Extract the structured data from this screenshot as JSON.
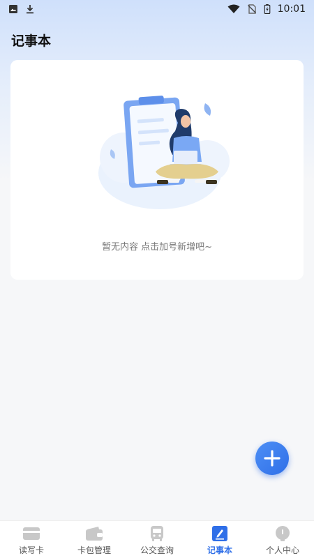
{
  "status_bar": {
    "time": "10:01",
    "icons": [
      "image-icon",
      "download-icon",
      "wifi-icon",
      "no-sim-icon",
      "battery-icon"
    ]
  },
  "page": {
    "title": "记事本"
  },
  "empty_state": {
    "message": "暂无内容 点击加号新增吧~",
    "illustration": "woman-with-laptop-clipboard-illustration"
  },
  "fab": {
    "icon": "plus-icon"
  },
  "tab_bar": {
    "active_index": 3,
    "tabs": [
      {
        "label": "读写卡",
        "icon": "card-icon"
      },
      {
        "label": "卡包管理",
        "icon": "wallet-icon"
      },
      {
        "label": "公交查询",
        "icon": "bus-icon"
      },
      {
        "label": "记事本",
        "icon": "notepad-icon"
      },
      {
        "label": "个人中心",
        "icon": "person-icon"
      }
    ]
  },
  "colors": {
    "accent": "#2f6fe8",
    "inactive_icon": "#c8c8c8",
    "background": "#f6f7f9"
  }
}
